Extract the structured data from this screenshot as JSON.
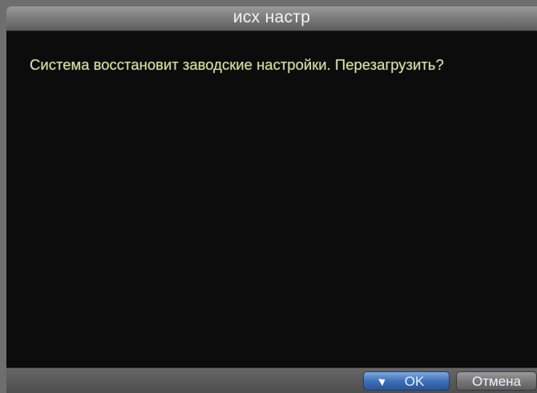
{
  "dialog": {
    "title": "исх настр",
    "message": "Система восстановит заводские настройки. Перезагрузить?"
  },
  "buttons": {
    "ok_label": "OK",
    "cancel_label": "Отмена"
  },
  "colors": {
    "background": "#0c0c0c",
    "message_text": "#d8dca8",
    "ok_accent": "#3f70b8"
  },
  "icons": {
    "cursor": "mouse-pointer-icon"
  }
}
